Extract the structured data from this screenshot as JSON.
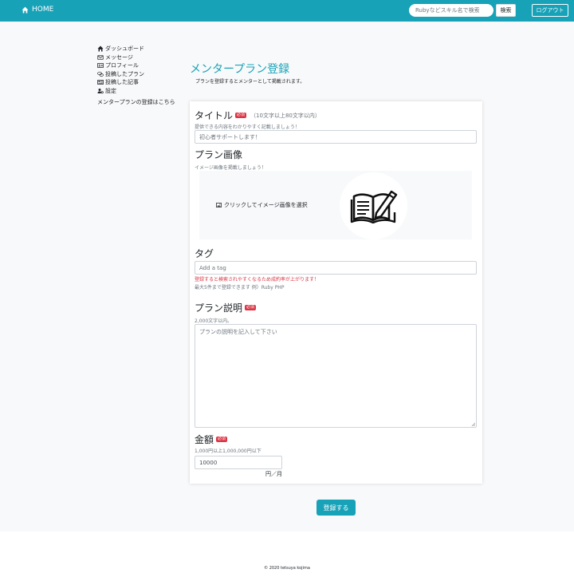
{
  "header": {
    "brand": "HOME",
    "search_placeholder": "Rubyなどスキル名で検索",
    "search_button": "検索",
    "logout": "ログアウト"
  },
  "sidebar": {
    "items": [
      {
        "label": "ダッシュボード",
        "icon": "home-icon"
      },
      {
        "label": "メッセージ",
        "icon": "envelope-icon"
      },
      {
        "label": "プロフィール",
        "icon": "id-card-icon"
      },
      {
        "label": "投稿したプラン",
        "icon": "comments-icon"
      },
      {
        "label": "投稿した記事",
        "icon": "newspaper-icon"
      },
      {
        "label": "設定",
        "icon": "user-cog-icon"
      }
    ],
    "register_link": "メンタープランの登録はこちら"
  },
  "page": {
    "title": "メンタープラン登録",
    "subtitle": "プランを登録するとメンターとして掲載されます。"
  },
  "form": {
    "required_badge": "必須",
    "title": {
      "label": "タイトル",
      "note": "（10文字以上80文字以内）",
      "help": "提供できる内容をわかりやすく記載しましょう！",
      "placeholder": "初心者サポートします！"
    },
    "image": {
      "label": "プラン画像",
      "help": "イメージ画像を掲載しましょう！",
      "select_text": "クリックしてイメージ画像を選択"
    },
    "tag": {
      "label": "タグ",
      "placeholder": "Add a tag",
      "warning": "登録すると検索されやすくなるため成約率が上がります！",
      "help": "最大5件まで登録できます 例）Ruby PHP"
    },
    "description": {
      "label": "プラン説明",
      "help": "2,000文字以内。",
      "placeholder": "プランの説明を記入して下さい"
    },
    "price": {
      "label": "金額",
      "help": "1,000円以上1,000,000円以下",
      "value": "10000",
      "unit": "円／月"
    },
    "submit": "登録する"
  },
  "footer": {
    "text": "© 2020 tetsuya kojima"
  },
  "colors": {
    "primary": "#17a2b8",
    "danger": "#dc3545",
    "background": "#f8f9fa"
  }
}
